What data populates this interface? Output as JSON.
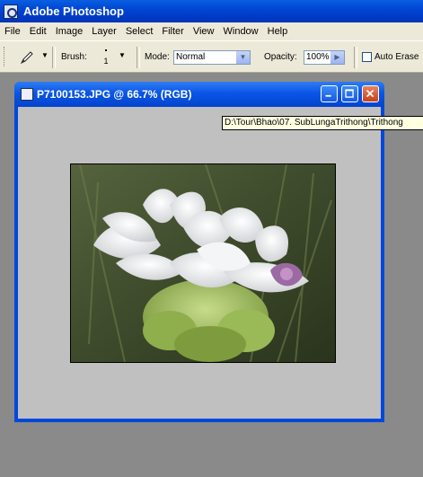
{
  "app": {
    "title": "Adobe Photoshop"
  },
  "menu": [
    "File",
    "Edit",
    "Image",
    "Layer",
    "Select",
    "Filter",
    "View",
    "Window",
    "Help"
  ],
  "options": {
    "brush_label": "Brush:",
    "brush_size": "1",
    "mode_label": "Mode:",
    "mode_value": "Normal",
    "opacity_label": "Opacity:",
    "opacity_value": "100%",
    "auto_erase_label": "Auto Erase",
    "auto_erase_checked": false
  },
  "document": {
    "title": "P7100153.JPG @ 66.7% (RGB)",
    "tooltip": "D:\\Tour\\Bhao\\07. SubLungaTrithong\\Trithong",
    "image_description_icon": "flower-photo"
  },
  "colors": {
    "titlebar": "#0046d6",
    "workspace": "#8a8a8a",
    "canvas": "#c0c0c0",
    "chrome": "#ece9d8"
  }
}
